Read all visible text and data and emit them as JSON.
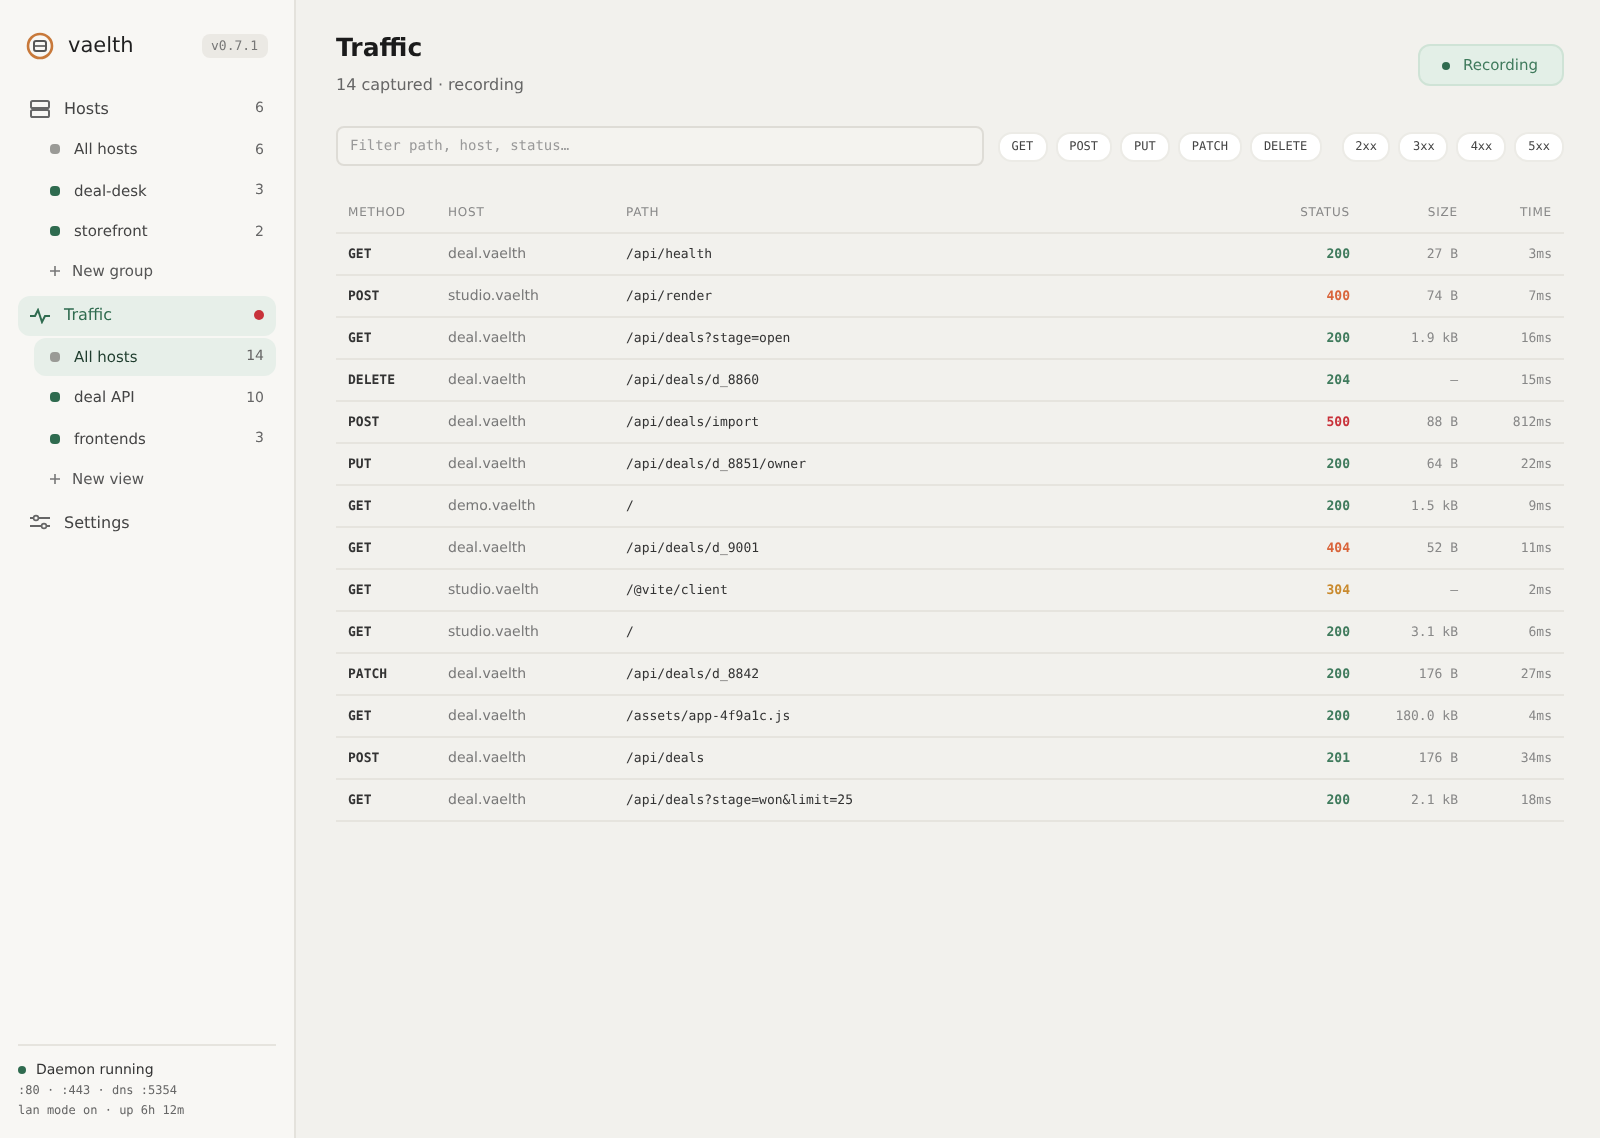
{
  "app": {
    "name": "vaelth",
    "version": "v0.7.1"
  },
  "sidebar": {
    "sections": [
      {
        "kind": "hosts",
        "label": "Hosts",
        "count": "6",
        "selected": false,
        "alert": false,
        "items": [
          {
            "label": "All hosts",
            "count": "6",
            "color": "#9a9a96",
            "selected": false
          },
          {
            "label": "deal-desk",
            "count": "3",
            "color": "#2f6b4f",
            "selected": false
          },
          {
            "label": "storefront",
            "count": "2",
            "color": "#2f6b4f",
            "selected": false
          }
        ],
        "add": "New group"
      },
      {
        "kind": "traffic",
        "label": "Traffic",
        "selected": true,
        "alert": true,
        "items": [
          {
            "label": "All hosts",
            "count": "14",
            "color": "#9a9a96",
            "selected": true
          },
          {
            "label": "deal API",
            "count": "10",
            "color": "#2f6b4f",
            "selected": false
          },
          {
            "label": "frontends",
            "count": "3",
            "color": "#2f6b4f",
            "selected": false
          }
        ],
        "add": "New view"
      },
      {
        "kind": "settings",
        "label": "Settings",
        "selected": false,
        "alert": false
      }
    ],
    "footer": {
      "status": "Daemon running",
      "running": true,
      "ports": ":80 · :443 · dns :5354",
      "uptime": "lan mode on · up 6h 12m"
    }
  },
  "page": {
    "title": "Traffic",
    "subtitle": "14 captured · recording",
    "recording": {
      "label": "Recording",
      "on": true
    }
  },
  "filter": {
    "placeholder": "Filter path, host, status…",
    "methods": [
      "GET",
      "POST",
      "PUT",
      "PATCH",
      "DELETE"
    ],
    "statuses": [
      "2xx",
      "3xx",
      "4xx",
      "5xx"
    ]
  },
  "table": {
    "columns": [
      "METHOD",
      "HOST",
      "PATH",
      "STATUS",
      "SIZE",
      "TIME"
    ],
    "rows": [
      {
        "method": "GET",
        "host": "deal.vaelth",
        "path": "/api/health",
        "status": "200",
        "color": "#3f7a5c",
        "size": "27 B",
        "time": "3ms"
      },
      {
        "method": "POST",
        "host": "studio.vaelth",
        "path": "/api/render",
        "status": "400",
        "color": "#d9643a",
        "size": "74 B",
        "time": "7ms"
      },
      {
        "method": "GET",
        "host": "deal.vaelth",
        "path": "/api/deals?stage=open",
        "status": "200",
        "color": "#3f7a5c",
        "size": "1.9 kB",
        "time": "16ms"
      },
      {
        "method": "DELETE",
        "host": "deal.vaelth",
        "path": "/api/deals/d_8860",
        "status": "204",
        "color": "#3f7a5c",
        "size": "—",
        "time": "15ms"
      },
      {
        "method": "POST",
        "host": "deal.vaelth",
        "path": "/api/deals/import",
        "status": "500",
        "color": "#c8323a",
        "size": "88 B",
        "time": "812ms"
      },
      {
        "method": "PUT",
        "host": "deal.vaelth",
        "path": "/api/deals/d_8851/owner",
        "status": "200",
        "color": "#3f7a5c",
        "size": "64 B",
        "time": "22ms"
      },
      {
        "method": "GET",
        "host": "demo.vaelth",
        "path": "/",
        "status": "200",
        "color": "#3f7a5c",
        "size": "1.5 kB",
        "time": "9ms"
      },
      {
        "method": "GET",
        "host": "deal.vaelth",
        "path": "/api/deals/d_9001",
        "status": "404",
        "color": "#d9643a",
        "size": "52 B",
        "time": "11ms"
      },
      {
        "method": "GET",
        "host": "studio.vaelth",
        "path": "/@vite/client",
        "status": "304",
        "color": "#c98a2e",
        "size": "—",
        "time": "2ms"
      },
      {
        "method": "GET",
        "host": "studio.vaelth",
        "path": "/",
        "status": "200",
        "color": "#3f7a5c",
        "size": "3.1 kB",
        "time": "6ms"
      },
      {
        "method": "PATCH",
        "host": "deal.vaelth",
        "path": "/api/deals/d_8842",
        "status": "200",
        "color": "#3f7a5c",
        "size": "176 B",
        "time": "27ms"
      },
      {
        "method": "GET",
        "host": "deal.vaelth",
        "path": "/assets/app-4f9a1c.js",
        "status": "200",
        "color": "#3f7a5c",
        "size": "180.0 kB",
        "time": "4ms"
      },
      {
        "method": "POST",
        "host": "deal.vaelth",
        "path": "/api/deals",
        "status": "201",
        "color": "#3f7a5c",
        "size": "176 B",
        "time": "34ms"
      },
      {
        "method": "GET",
        "host": "deal.vaelth",
        "path": "/api/deals?stage=won&limit=25",
        "status": "200",
        "color": "#3f7a5c",
        "size": "2.1 kB",
        "time": "18ms"
      }
    ]
  }
}
